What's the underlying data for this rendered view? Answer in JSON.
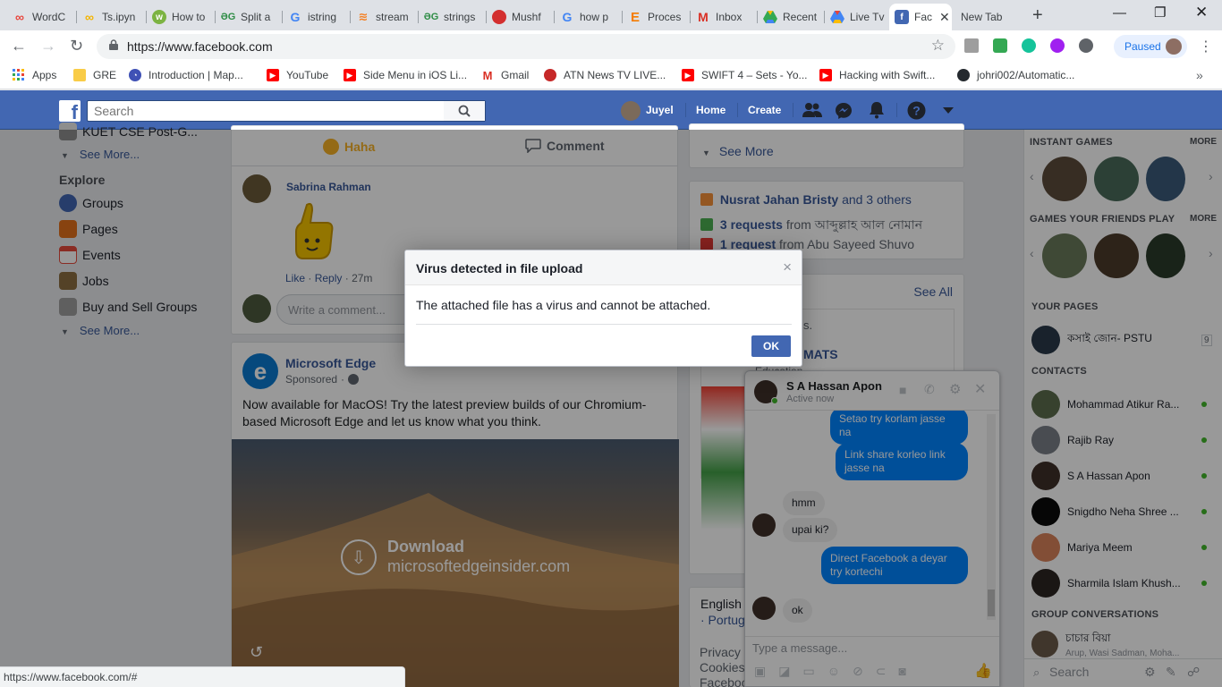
{
  "browser": {
    "tabs": [
      {
        "label": "WordC",
        "icon": "infinity-icon",
        "color": "#e8453c"
      },
      {
        "label": "Ts.ipyn",
        "icon": "infinity-icon",
        "color": "#f4b400"
      },
      {
        "label": "How to",
        "icon": "how-icon",
        "color": "#7cb342"
      },
      {
        "label": "Split a",
        "icon": "gfg-icon",
        "color": "#2f8d46"
      },
      {
        "label": "istring",
        "icon": "google-icon",
        "color": "#4285f4"
      },
      {
        "label": "stream",
        "icon": "stackoverflow-icon",
        "color": "#f48024"
      },
      {
        "label": "strings",
        "icon": "gfg-icon",
        "color": "#2f8d46"
      },
      {
        "label": "Mushf",
        "icon": "red-circle-icon",
        "color": "#d32f2f"
      },
      {
        "label": "how p",
        "icon": "google-icon",
        "color": "#4285f4"
      },
      {
        "label": "Proces",
        "icon": "e-icon",
        "color": "#f57c00"
      },
      {
        "label": "Inbox",
        "icon": "gmail-icon",
        "color": "#d93025"
      },
      {
        "label": "Recent",
        "icon": "drive-icon",
        "color": "#34a853"
      },
      {
        "label": "Live Tv",
        "icon": "drive-icon",
        "color": "#4285f4"
      },
      {
        "label": "Fac",
        "icon": "facebook-icon",
        "color": "#4267b2",
        "active": true
      },
      {
        "label": "New Tab",
        "icon": "none",
        "color": "#ffffff"
      }
    ],
    "url": "https://www.facebook.com",
    "profile_status": "Paused",
    "bookmarks": [
      {
        "label": "Apps",
        "icon": "apps-grid-icon",
        "color": "#4285f4"
      },
      {
        "label": "GRE",
        "icon": "folder-icon",
        "color": "#f9cc47"
      },
      {
        "label": "Introduction | Map...",
        "icon": "circle-icon",
        "color": "#3f51b5"
      },
      {
        "label": "YouTube",
        "icon": "youtube-icon",
        "color": "#ff0000"
      },
      {
        "label": "Side Menu in iOS Li...",
        "icon": "youtube-icon",
        "color": "#ff0000"
      },
      {
        "label": "Gmail",
        "icon": "gmail-icon",
        "color": "#d93025"
      },
      {
        "label": "ATN News TV LIVE...",
        "icon": "circle-icon",
        "color": "#c62828"
      },
      {
        "label": "SWIFT 4 – Sets - Yo...",
        "icon": "youtube-icon",
        "color": "#ff0000"
      },
      {
        "label": "Hacking with Swift...",
        "icon": "youtube-icon",
        "color": "#ff0000"
      },
      {
        "label": "johri002/Automatic...",
        "icon": "github-icon",
        "color": "#24292e"
      }
    ],
    "status_url": "https://www.facebook.com/#"
  },
  "fb": {
    "search_placeholder": "Search",
    "user_name": "Juyel",
    "nav_home": "Home",
    "nav_create": "Create"
  },
  "leftnav": {
    "cut_item": "KUET CSE Post-G...",
    "see_more_1": "See More...",
    "explore_title": "Explore",
    "explore": [
      {
        "label": "Groups",
        "icon": "groups-icon",
        "color": "#4267b2"
      },
      {
        "label": "Pages",
        "icon": "pages-icon",
        "color": "#e3711b"
      },
      {
        "label": "Events",
        "icon": "events-icon",
        "color": "#e64a3c"
      },
      {
        "label": "Jobs",
        "icon": "jobs-icon",
        "color": "#8d6e42"
      },
      {
        "label": "Buy and Sell Groups",
        "icon": "buy-sell-icon",
        "color": "#7f7f7f"
      }
    ],
    "see_more_2": "See More..."
  },
  "feed": {
    "reaction_haha": "Haha",
    "reaction_comment": "Comment",
    "commenter": "Sabrina Rahman",
    "comment_like": "Like",
    "comment_reply": "Reply",
    "comment_time": "27m",
    "write_comment_placeholder": "Write a comment...",
    "ad_name": "Microsoft Edge",
    "ad_sponsored": "Sponsored",
    "ad_text": "Now available for MacOS! Try the latest preview builds of our Chromium-based Microsoft Edge and let us know what you think.",
    "ad_download": "Download",
    "ad_domain": "microsoftedgeinsider.com"
  },
  "rightcol": {
    "see_more": "See More",
    "birthday_names": "Nusrat Jahan Bristy",
    "birthday_others": "and 3 others",
    "request_1_count": "3 requests",
    "request_1_from": "from আব্দুল্লাহ আল নোমান",
    "request_2_count": "1 request",
    "request_2_from": "from Abu Sayeed Shuvo",
    "see_all": "See All",
    "page_snippet": "s.",
    "page_name_partial": "MATS",
    "page_category": "Education",
    "lang_english": "English (",
    "lang_portugues": "· Portugu",
    "footer_privacy": "Privacy ·",
    "footer_cookies": "Cookies",
    "footer_facebook": "Facebook"
  },
  "farright": {
    "instant_games": "INSTANT GAMES",
    "games_friends": "GAMES YOUR FRIENDS PLAY",
    "more": "MORE",
    "your_pages": "YOUR PAGES",
    "page_name": "কসাই জোন- PSTU",
    "page_badge": "9",
    "contacts_title": "CONTACTS",
    "contacts": [
      {
        "name": "Mohammad Atikur Ra...",
        "color": "#5d6d4e"
      },
      {
        "name": "Rajib Ray",
        "color": "#7a7f88"
      },
      {
        "name": "S A Hassan Apon",
        "color": "#3e2f28"
      },
      {
        "name": "Snigdho Neha Shree ...",
        "color": "#0a0a0a"
      },
      {
        "name": "Mariya Meem",
        "color": "#d9825b"
      },
      {
        "name": "Sharmila Islam Khush...",
        "color": "#2c2622"
      }
    ],
    "group_conv_title": "GROUP CONVERSATIONS",
    "group_name": "চাচার বিয়া",
    "group_members": "Arup, Wasi Sadman, Moha...",
    "search_placeholder": "Search"
  },
  "chat": {
    "name": "S A Hassan Apon",
    "status": "Active now",
    "messages": [
      {
        "from": "me",
        "text": "Setao try korlam jasse na"
      },
      {
        "from": "me",
        "text": "Link share korleo link jasse na"
      },
      {
        "from": "them",
        "text": "hmm"
      },
      {
        "from": "them",
        "text": "upai  ki?"
      },
      {
        "from": "me",
        "text": "Direct Facebook a deyar try kortechi"
      },
      {
        "from": "them",
        "text": "ok"
      }
    ],
    "input_placeholder": "Type a message..."
  },
  "dialog": {
    "title": "Virus detected in file upload",
    "message": "The attached file has a virus and cannot be attached.",
    "ok_label": "OK",
    "close_glyph": "×"
  }
}
